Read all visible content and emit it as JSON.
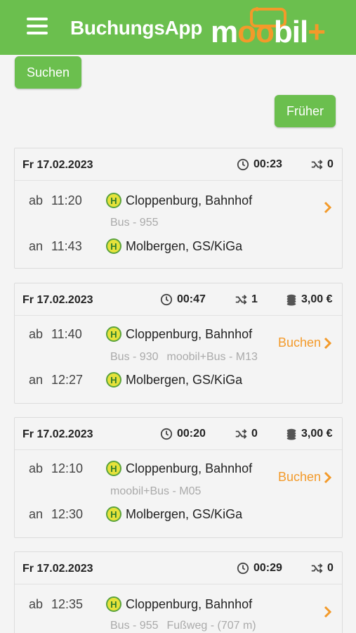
{
  "header": {
    "app_title": "BuchungsApp",
    "logo": {
      "part1": "m",
      "o1": "o",
      "o2": "o",
      "part2": "bil",
      "plus": "+"
    }
  },
  "buttons": {
    "search": "Suchen",
    "earlier": "Früher"
  },
  "colors": {
    "brand_green": "#6bbf4e",
    "accent_orange": "#f39a2a",
    "stop_yellow": "#e6e23a"
  },
  "labels": {
    "dep": "ab",
    "arr": "an"
  },
  "trips": [
    {
      "date": "Fr 17.02.2023",
      "duration": "00:23",
      "changes": "0",
      "price": "",
      "dep_time": "11:20",
      "dep_stop": "Cloppenburg, Bahnhof",
      "arr_time": "11:43",
      "arr_stop": "Molbergen, GS/KiGa",
      "lines": [
        "Bus - 955"
      ],
      "action": ""
    },
    {
      "date": "Fr 17.02.2023",
      "duration": "00:47",
      "changes": "1",
      "price": "3,00 €",
      "dep_time": "11:40",
      "dep_stop": "Cloppenburg, Bahnhof",
      "arr_time": "12:27",
      "arr_stop": "Molbergen, GS/KiGa",
      "lines": [
        "Bus - 930",
        "moobil+Bus - M13"
      ],
      "action": "Buchen"
    },
    {
      "date": "Fr 17.02.2023",
      "duration": "00:20",
      "changes": "0",
      "price": "3,00 €",
      "dep_time": "12:10",
      "dep_stop": "Cloppenburg, Bahnhof",
      "arr_time": "12:30",
      "arr_stop": "Molbergen, GS/KiGa",
      "lines": [
        "moobil+Bus - M05"
      ],
      "action": "Buchen"
    },
    {
      "date": "Fr 17.02.2023",
      "duration": "00:29",
      "changes": "0",
      "price": "",
      "dep_time": "12:35",
      "dep_stop": "Cloppenburg, Bahnhof",
      "arr_time": "",
      "arr_stop": "",
      "lines": [
        "Bus - 955",
        "Fußweg - (707 m)"
      ],
      "action": ""
    }
  ]
}
